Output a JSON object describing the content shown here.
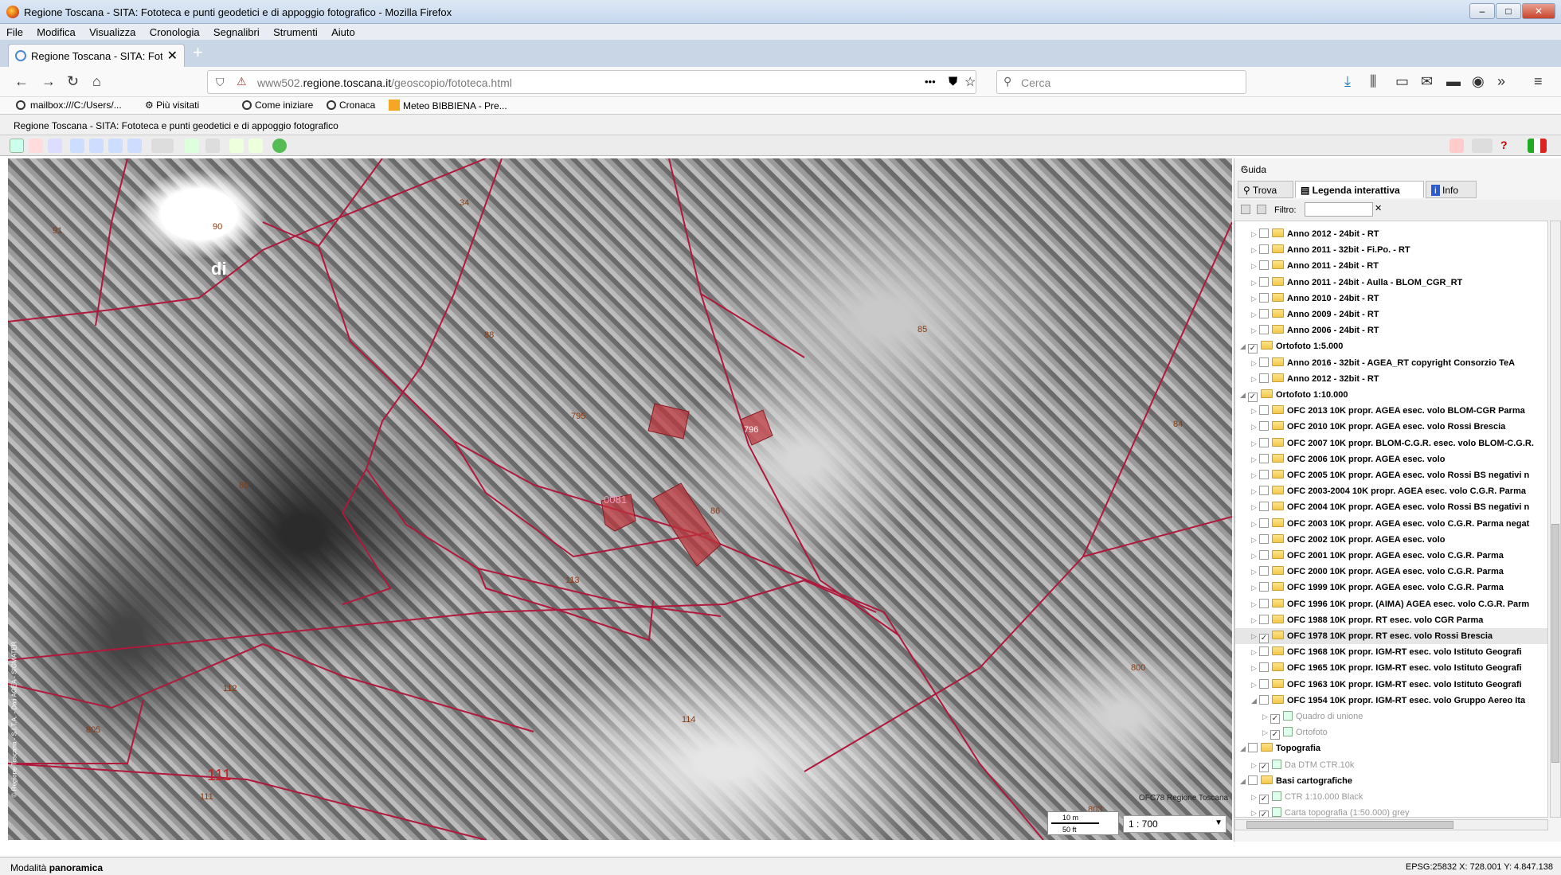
{
  "window": {
    "title": "Regione Toscana - SITA: Fototeca e punti geodetici e di appoggio fotografico - Mozilla Firefox",
    "btn_min": "–",
    "btn_max": "□",
    "btn_close": "✕"
  },
  "menu": [
    "File",
    "Modifica",
    "Visualizza",
    "Cronologia",
    "Segnalibri",
    "Strumenti",
    "Aiuto"
  ],
  "tab": {
    "label": "Regione Toscana - SITA: Fototec",
    "close": "✕",
    "new": "+"
  },
  "nav": {
    "url_prefix": "www502.",
    "url_domain": "regione.toscana.it",
    "url_path": "/geoscopio/fototeca.html",
    "more": "•••",
    "search_placeholder": "Cerca"
  },
  "bookmarks": [
    "mailbox:///C:/Users/...",
    "Più visitati",
    "Come iniziare",
    "Cronaca",
    "Meteo BIBBIENA - Pre..."
  ],
  "page_title": "Regione Toscana - SITA: Fototeca e punti geodetici e di appoggio fotografico",
  "map": {
    "labels": [
      {
        "t": "91"
      },
      {
        "t": "90"
      },
      {
        "t": "34"
      },
      {
        "t": "di"
      },
      {
        "t": "88"
      },
      {
        "t": "85"
      },
      {
        "t": "795"
      },
      {
        "t": "796"
      },
      {
        "t": "84"
      },
      {
        "t": "89"
      },
      {
        "t": "0081"
      },
      {
        "t": "86"
      },
      {
        "t": "113"
      },
      {
        "t": "112"
      },
      {
        "t": "805"
      },
      {
        "t": "114"
      },
      {
        "t": "111"
      },
      {
        "t": "111"
      },
      {
        "t": "800"
      },
      {
        "t": "803"
      }
    ],
    "watermark": "OFC78 Regione Toscana",
    "copyright": "© Regione Toscana - S.I.T.A. - Dati AGEA - SIGMATER",
    "scale_m": "10 m",
    "scale_ft": "50 ft",
    "scale": "1 : 700"
  },
  "panel": {
    "header": "Guida",
    "tabs": [
      "Trova",
      "Legenda interattiva",
      "Info"
    ],
    "filter_label": "Filtro:",
    "tree": [
      {
        "t": "Anno 2012 - 24bit - RT",
        "lvl": 1,
        "chk": false
      },
      {
        "t": "Anno 2011 - 32bit - Fi.Po. - RT",
        "lvl": 1,
        "chk": false
      },
      {
        "t": "Anno 2011 - 24bit - RT",
        "lvl": 1,
        "chk": false
      },
      {
        "t": "Anno 2011 - 24bit - Aulla - BLOM_CGR_RT",
        "lvl": 1,
        "chk": false
      },
      {
        "t": "Anno 2010 - 24bit - RT",
        "lvl": 1,
        "chk": false
      },
      {
        "t": "Anno 2009 - 24bit - RT",
        "lvl": 1,
        "chk": false
      },
      {
        "t": "Anno 2006 - 24bit - RT",
        "lvl": 1,
        "chk": false
      },
      {
        "t": "Ortofoto 1:5.000",
        "lvl": 0,
        "chk": true,
        "open": true
      },
      {
        "t": "Anno 2016 - 32bit - AGEA_RT copyright Consorzio TeA",
        "lvl": 1,
        "chk": false
      },
      {
        "t": "Anno 2012 - 32bit - RT",
        "lvl": 1,
        "chk": false
      },
      {
        "t": "Ortofoto 1:10.000",
        "lvl": 0,
        "chk": true,
        "open": true
      },
      {
        "t": "OFC 2013 10K propr. AGEA esec. volo BLOM-CGR Parma",
        "lvl": 1,
        "chk": false
      },
      {
        "t": "OFC 2010 10K propr. AGEA esec. volo Rossi Brescia",
        "lvl": 1,
        "chk": false
      },
      {
        "t": "OFC 2007 10K propr. BLOM-C.G.R. esec. volo BLOM-C.G.R.",
        "lvl": 1,
        "chk": false
      },
      {
        "t": "OFC 2006 10K propr. AGEA esec. volo",
        "lvl": 1,
        "chk": false
      },
      {
        "t": "OFC 2005 10K propr. AGEA esec. volo Rossi BS negativi n",
        "lvl": 1,
        "chk": false
      },
      {
        "t": "OFC 2003-2004 10K propr. AGEA esec. volo C.G.R. Parma",
        "lvl": 1,
        "chk": false
      },
      {
        "t": "OFC 2004 10K propr. AGEA esec. volo Rossi BS negativi n",
        "lvl": 1,
        "chk": false
      },
      {
        "t": "OFC 2003 10K propr. AGEA esec. volo C.G.R. Parma negat",
        "lvl": 1,
        "chk": false
      },
      {
        "t": "OFC 2002 10K propr. AGEA esec. volo",
        "lvl": 1,
        "chk": false
      },
      {
        "t": "OFC 2001 10K propr. AGEA esec. volo C.G.R. Parma",
        "lvl": 1,
        "chk": false
      },
      {
        "t": "OFC 2000 10K propr. AGEA esec. volo C.G.R. Parma",
        "lvl": 1,
        "chk": false
      },
      {
        "t": "OFC 1999 10K propr. AGEA esec. volo C.G.R. Parma",
        "lvl": 1,
        "chk": false
      },
      {
        "t": "OFC 1996 10K propr. (AIMA) AGEA esec. volo C.G.R. Parm",
        "lvl": 1,
        "chk": false
      },
      {
        "t": "OFC 1988 10K propr. RT esec. volo CGR Parma",
        "lvl": 1,
        "chk": false
      },
      {
        "t": "OFC 1978 10K propr. RT esec. volo Rossi Brescia",
        "lvl": 1,
        "chk": true,
        "sel": true
      },
      {
        "t": "OFC 1968 10K propr. IGM-RT esec. volo Istituto Geografi",
        "lvl": 1,
        "chk": false
      },
      {
        "t": "OFC 1965 10K propr. IGM-RT esec. volo Istituto Geografi",
        "lvl": 1,
        "chk": false
      },
      {
        "t": "OFC 1963 10K propr. IGM-RT esec. volo Istituto Geografi",
        "lvl": 1,
        "chk": false
      },
      {
        "t": "OFC 1954 10K propr. IGM-RT esec. volo Gruppo Aereo Ita",
        "lvl": 1,
        "chk": false,
        "open": true
      },
      {
        "t": "Quadro di unione",
        "lvl": 2,
        "chk": true,
        "sub": true
      },
      {
        "t": "Ortofoto",
        "lvl": 2,
        "chk": true,
        "sub": true
      },
      {
        "t": "Topografia",
        "lvl": 0,
        "chk": false,
        "open": true
      },
      {
        "t": "Da DTM CTR.10k",
        "lvl": 1,
        "chk": true,
        "sub": true
      },
      {
        "t": "Basi cartografiche",
        "lvl": 0,
        "chk": false,
        "open": true
      },
      {
        "t": "CTR 1:10.000 Black",
        "lvl": 1,
        "chk": true,
        "sub": true
      },
      {
        "t": "Carta topografia (1:50.000) grey",
        "lvl": 1,
        "chk": true,
        "sub": true
      }
    ]
  },
  "status": {
    "mode_label": "Modalità",
    "mode_value": "panoramica",
    "coords": "EPSG:25832  X: 728.001  Y: 4.847.138"
  },
  "colors": {
    "parcel_line": "#b0183c",
    "building_fill": "#c0333a",
    "title_grad": "#c6d8ee"
  }
}
